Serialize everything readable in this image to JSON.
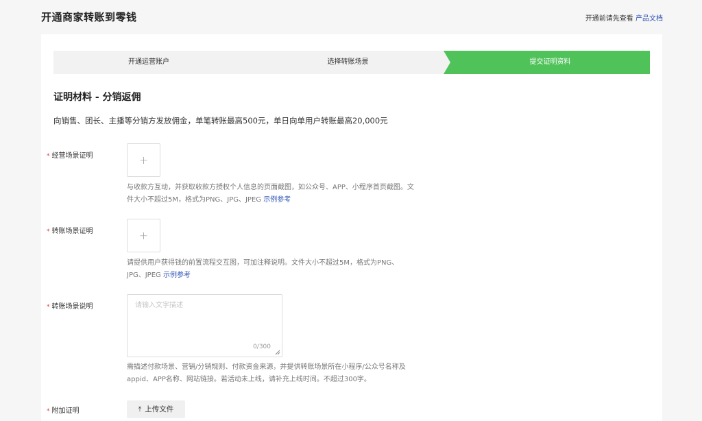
{
  "header": {
    "title": "开通商家转账到零钱",
    "note": "开通前请先查看",
    "doc_link": "产品文档"
  },
  "steps": [
    {
      "label": "开通运营账户",
      "active": false
    },
    {
      "label": "选择转账场景",
      "active": false
    },
    {
      "label": "提交证明资料",
      "active": true
    }
  ],
  "colors": {
    "step_active": "#4fc25a",
    "link": "#2f54b5",
    "required": "#e23b2e"
  },
  "section": {
    "title": "证明材料 - 分销返佣",
    "desc": "向销售、团长、主播等分销方发放佣金，单笔转账最高500元，单日向单用户转账最高20,000元"
  },
  "fields": {
    "business_proof": {
      "required_mark": "*",
      "label": "经营场景证明",
      "upload_icon": "plus-icon",
      "help": "与收款方互动，并获取收款方授权个人信息的页面截图，如公众号、APP、小程序首页截图。文件大小不超过5M，格式为PNG、JPG、JPEG",
      "example_link": "示例参考"
    },
    "transfer_proof": {
      "required_mark": "*",
      "label": "转账场景证明",
      "upload_icon": "plus-icon",
      "help": "请提供用户获得钱的前置流程交互图，可加注释说明。文件大小不超过5M，格式为PNG、JPG、JPEG",
      "example_link": "示例参考"
    },
    "transfer_desc": {
      "required_mark": "*",
      "label": "转账场景说明",
      "placeholder": "请输入文字描述",
      "value": "",
      "counter": "0/300",
      "help": "需描述付款场景、营销/分销规则、付款资金来源，并提供转账场景所在小程序/公众号名称及appid、APP名称、网站链接。若活动未上线，请补充上线时间。不超过300字。"
    },
    "attachment": {
      "required_mark": "*",
      "label": "附加证明",
      "button_icon": "upload-icon",
      "button_label": "上传文件"
    }
  }
}
